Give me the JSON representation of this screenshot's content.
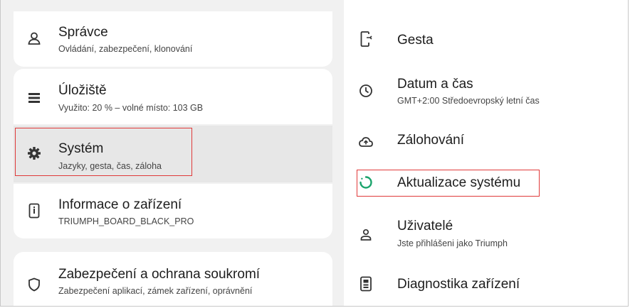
{
  "left_menu": {
    "items": [
      {
        "title": "Správce",
        "subtitle": "Ovládání, zabezpečení, klonování",
        "icon": "admin-icon"
      },
      {
        "title": "Úložiště",
        "subtitle": "Využito: 20 % – volné místo: 103 GB",
        "icon": "storage-icon"
      },
      {
        "title": "Systém",
        "subtitle": "Jazyky, gesta, čas, záloha",
        "icon": "gear-icon"
      },
      {
        "title": "Informace o zařízení",
        "subtitle": "TRIUMPH_BOARD_BLACK_PRO",
        "icon": "device-info-icon"
      },
      {
        "title": "Zabezpečení a ochrana soukromí",
        "subtitle": "Zabezpečení aplikací, zámek zařízení, oprávnění",
        "icon": "shield-icon"
      }
    ]
  },
  "right_menu": {
    "items": [
      {
        "title": "Gesta",
        "subtitle": "",
        "icon": "gesture-icon"
      },
      {
        "title": "Datum a čas",
        "subtitle": "GMT+2:00 Středoevropský letní čas",
        "icon": "clock-icon"
      },
      {
        "title": "Zálohování",
        "subtitle": "",
        "icon": "cloud-upload-icon"
      },
      {
        "title": "Aktualizace systému",
        "subtitle": "",
        "icon": "system-update-icon"
      },
      {
        "title": "Uživatelé",
        "subtitle": "Jste přihlášeni jako Triumph",
        "icon": "user-icon"
      },
      {
        "title": "Diagnostika zařízení",
        "subtitle": "",
        "icon": "diagnostics-icon"
      }
    ]
  },
  "colors": {
    "highlight": "#e03a3a",
    "update_accent": "#1aa36b",
    "selected_card": "#e7e7e7"
  }
}
